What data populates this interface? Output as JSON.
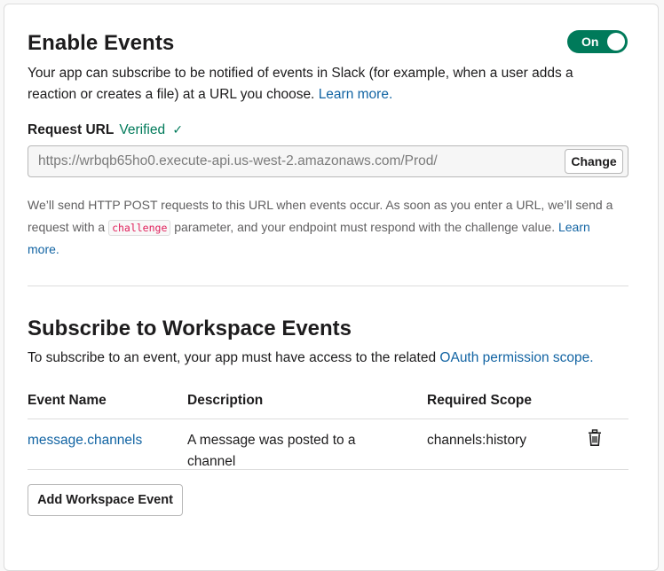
{
  "enable_events": {
    "title": "Enable Events",
    "toggle_label": "On",
    "description": "Your app can subscribe to be notified of events in Slack (for example, when a user adds a reaction or creates a file) at a URL you choose.",
    "learn_more": "Learn more."
  },
  "request_url": {
    "label": "Request URL",
    "status": "Verified",
    "status_icon": "✓",
    "value": "https://wrbqb65ho0.execute-api.us-west-2.amazonaws.com/Prod/",
    "change_button": "Change",
    "help_before": "We’ll send HTTP POST requests to this URL when events occur. As soon as you enter a URL, we’ll send a request with a",
    "help_code": "challenge",
    "help_after": "parameter, and your endpoint must respond with the challenge value.",
    "help_link": "Learn more."
  },
  "workspace_events": {
    "title": "Subscribe to Workspace Events",
    "description": "To subscribe to an event, your app must have access to the related",
    "scope_link": "OAuth permission scope.",
    "columns": {
      "event_name": "Event Name",
      "description": "Description",
      "required_scope": "Required Scope"
    },
    "rows": [
      {
        "event_name": "message.channels",
        "description": "A message was posted to a channel",
        "required_scope": "channels:history",
        "action_icon": "trash-icon"
      }
    ],
    "add_button": "Add Workspace Event"
  },
  "colors": {
    "accent_green": "#007a5a",
    "link_blue": "#1264a3",
    "code_red": "#e01e5a"
  }
}
